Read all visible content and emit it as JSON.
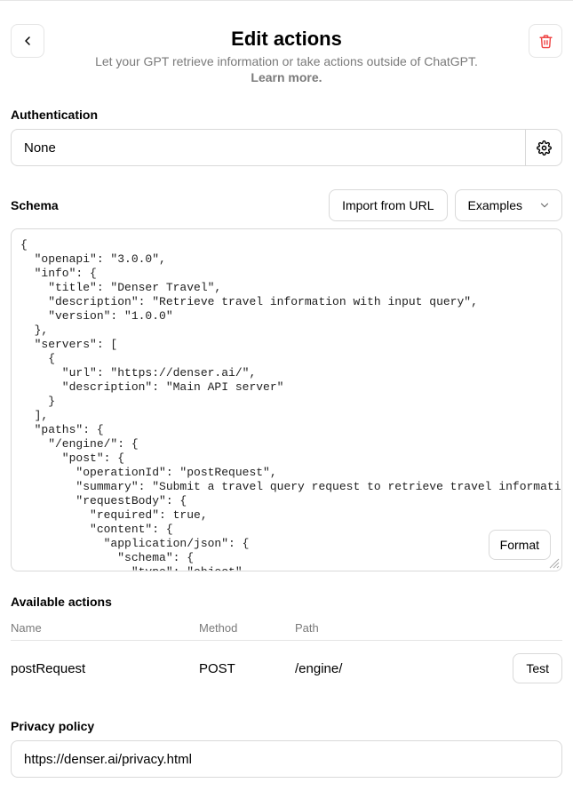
{
  "header": {
    "title": "Edit actions",
    "subtitle": "Let your GPT retrieve information or take actions outside of ChatGPT.",
    "learn_more": "Learn more."
  },
  "auth": {
    "label": "Authentication",
    "value": "None"
  },
  "schema": {
    "label": "Schema",
    "import_label": "Import from URL",
    "examples_label": "Examples",
    "format_label": "Format",
    "content": "{\n  \"openapi\": \"3.0.0\",\n  \"info\": {\n    \"title\": \"Denser Travel\",\n    \"description\": \"Retrieve travel information with input query\",\n    \"version\": \"1.0.0\"\n  },\n  \"servers\": [\n    {\n      \"url\": \"https://denser.ai/\",\n      \"description\": \"Main API server\"\n    }\n  ],\n  \"paths\": {\n    \"/engine/\": {\n      \"post\": {\n        \"operationId\": \"postRequest\",\n        \"summary\": \"Submit a travel query request to retrieve travel information\",\n        \"requestBody\": {\n          \"required\": true,\n          \"content\": {\n            \"application/json\": {\n              \"schema\": {\n                \"type\": \"object\","
  },
  "available_actions": {
    "label": "Available actions",
    "columns": {
      "name": "Name",
      "method": "Method",
      "path": "Path"
    },
    "rows": [
      {
        "name": "postRequest",
        "method": "POST",
        "path": "/engine/",
        "test_label": "Test"
      }
    ]
  },
  "privacy": {
    "label": "Privacy policy",
    "value": "https://denser.ai/privacy.html"
  }
}
